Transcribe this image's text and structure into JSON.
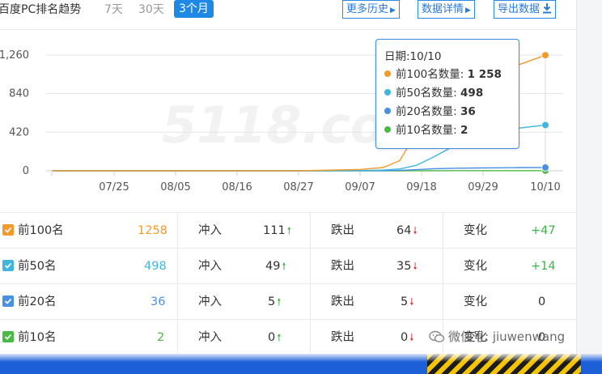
{
  "header": {
    "title": "百度PC排名趋势",
    "range_tabs": [
      {
        "label": "7天",
        "active": false
      },
      {
        "label": "30天",
        "active": false
      },
      {
        "label": "3个月",
        "active": true
      }
    ],
    "buttons": {
      "history": "更多历史",
      "details": "数据详情",
      "export": "导出数据"
    }
  },
  "chart_data": {
    "type": "line",
    "title": "",
    "xlabel": "",
    "ylabel": "",
    "ylim": [
      0,
      1260
    ],
    "yticks": [
      "1,260",
      "840",
      "420",
      "0"
    ],
    "ytick_values": [
      1260,
      840,
      420,
      0
    ],
    "x_tick_labels": [
      "07/25",
      "08/05",
      "08/16",
      "08/27",
      "09/07",
      "09/18",
      "09/29",
      "10/10"
    ],
    "x": [
      "07/14",
      "07/25",
      "08/05",
      "08/16",
      "08/27",
      "09/07",
      "09/11",
      "09/14",
      "09/17",
      "09/20",
      "09/24",
      "09/28",
      "10/02",
      "10/06",
      "10/10"
    ],
    "series": [
      {
        "name": "前100名",
        "color": "#f39a2b",
        "values": [
          0,
          0,
          0,
          0,
          0,
          15,
          35,
          110,
          420,
          720,
          900,
          1010,
          1100,
          1170,
          1258
        ]
      },
      {
        "name": "前50名",
        "color": "#3fb5e0",
        "values": [
          0,
          0,
          0,
          0,
          0,
          3,
          8,
          20,
          60,
          150,
          280,
          380,
          440,
          470,
          498
        ]
      },
      {
        "name": "前20名",
        "color": "#4a90e2",
        "values": [
          0,
          0,
          0,
          0,
          0,
          1,
          2,
          5,
          12,
          22,
          28,
          31,
          33,
          35,
          36
        ]
      },
      {
        "name": "前10名",
        "color": "#4cb944",
        "values": [
          0,
          0,
          0,
          0,
          0,
          0,
          0,
          0,
          1,
          1,
          2,
          2,
          2,
          2,
          2
        ]
      }
    ],
    "grid": true,
    "legend": "none",
    "watermark": "5118.com"
  },
  "tooltip": {
    "date_label": "日期:10/10",
    "rows": [
      {
        "label": "前100名数量: ",
        "value": "1 258",
        "color": "#f39a2b"
      },
      {
        "label": "前50名数量: ",
        "value": "498",
        "color": "#3fb5e0"
      },
      {
        "label": "前20名数量: ",
        "value": "36",
        "color": "#4a90e2"
      },
      {
        "label": "前10名数量: ",
        "value": "2",
        "color": "#4cb944"
      }
    ]
  },
  "table": {
    "rows": [
      {
        "name": "前100名",
        "checked": true,
        "check_color": "#f39a2b",
        "count": "1258",
        "count_color": "#f39a2b",
        "in_label": "冲入",
        "in_value": "111",
        "out_label": "跌出",
        "out_value": "64",
        "change_label": "变化",
        "change_value": "+47",
        "change_color": "#3cb34a"
      },
      {
        "name": "前50名",
        "checked": true,
        "check_color": "#3fb5e0",
        "count": "498",
        "count_color": "#3fb5e0",
        "in_label": "冲入",
        "in_value": "49",
        "out_label": "跌出",
        "out_value": "35",
        "change_label": "变化",
        "change_value": "+14",
        "change_color": "#3cb34a"
      },
      {
        "name": "前20名",
        "checked": true,
        "check_color": "#4a90e2",
        "count": "36",
        "count_color": "#4a90e2",
        "in_label": "冲入",
        "in_value": "5",
        "out_label": "跌出",
        "out_value": "5",
        "change_label": "变化",
        "change_value": "0",
        "change_color": "#333333"
      },
      {
        "name": "前10名",
        "checked": true,
        "check_color": "#4cb944",
        "count": "2",
        "count_color": "#4cb944",
        "in_label": "冲入",
        "in_value": "0",
        "out_label": "跌出",
        "out_value": "0",
        "change_label": "变化",
        "change_value": "0",
        "change_color": "#333333"
      }
    ]
  },
  "wechat_watermark": "微信号: jiuwenwang"
}
